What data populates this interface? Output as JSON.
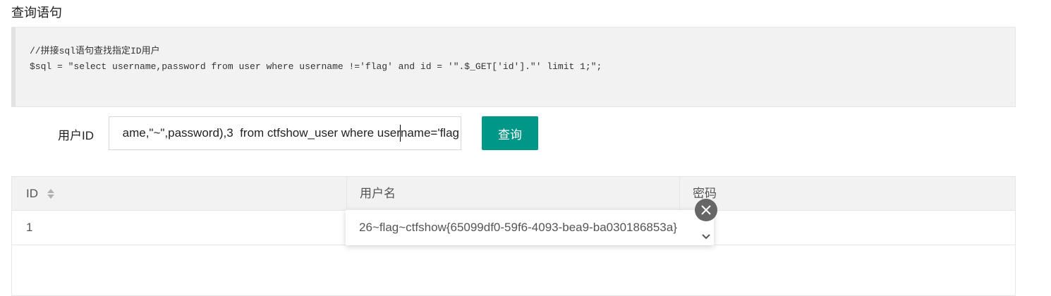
{
  "section": {
    "title": "查询语句"
  },
  "code": {
    "comment": "//拼接sql语句查找指定ID用户",
    "statement": "$sql = \"select username,password from user where username !='flag' and id = '\".$_GET['id'].\"' limit 1;\";"
  },
  "form": {
    "label": "用户ID",
    "input_value": "ame,\"~\",password),3  from ctfshow_user where username='flag",
    "submit_label": "查询"
  },
  "table": {
    "columns": [
      "ID",
      "用户名",
      "密码"
    ],
    "rows": [
      {
        "id": "1",
        "username": "",
        "password": ""
      }
    ]
  },
  "cell_popup": {
    "text": "26~flag~ctfshow{65099df0-59f6-4093-bea9-ba030186853a}",
    "close_icon": "close-icon",
    "expand_icon": "chevron-down-icon"
  },
  "colors": {
    "accent": "#009688",
    "code_bg": "#f2f2f2",
    "header_bg": "#f2f2f2"
  }
}
